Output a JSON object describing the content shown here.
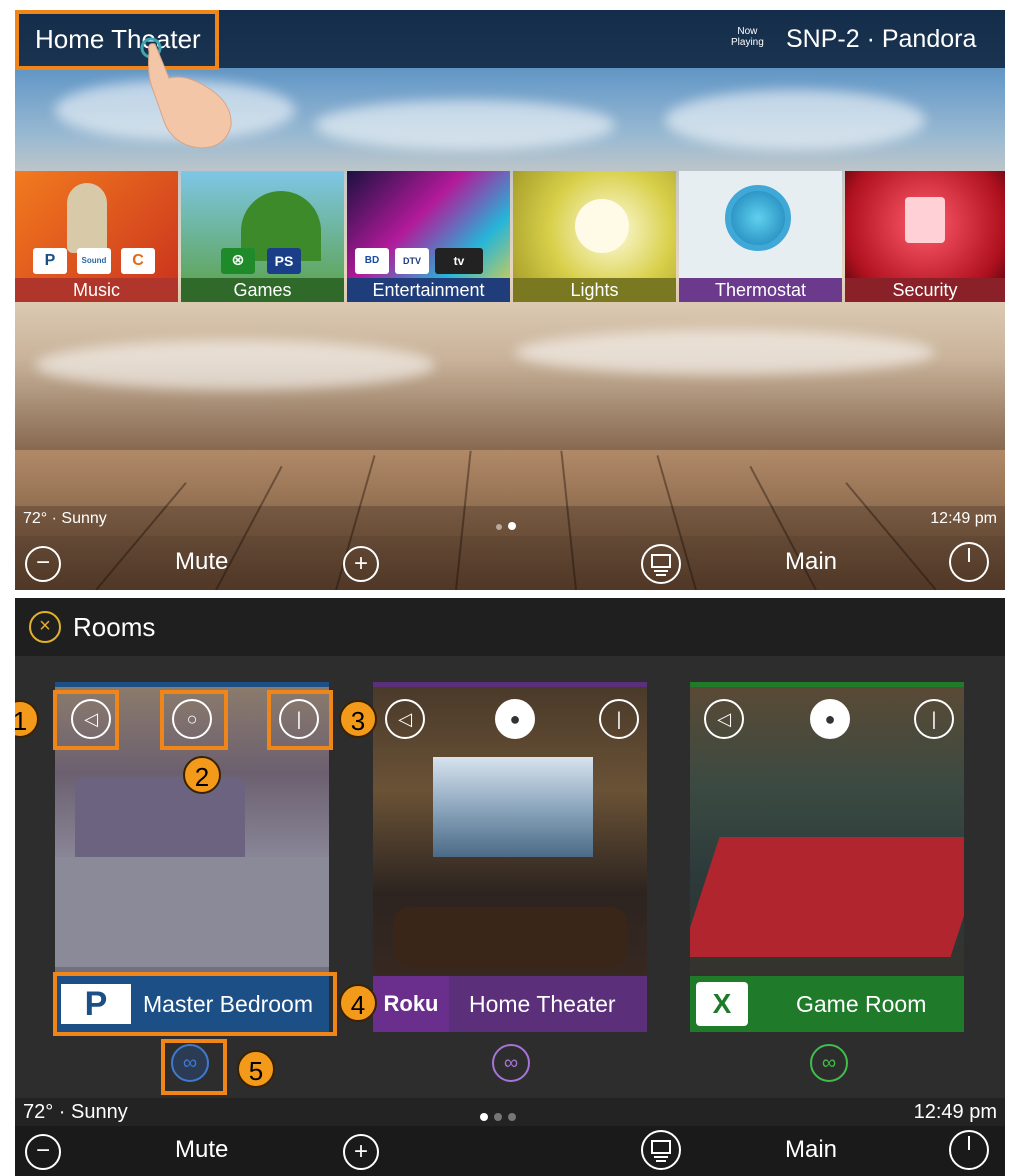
{
  "top_screen": {
    "title": "Home Theater",
    "now_playing_label": "Now\nPlaying",
    "now_playing_value": "SNP-2 · Pandora",
    "tiles": [
      {
        "label": "Music",
        "color": "#b0352a"
      },
      {
        "label": "Games",
        "color": "#2f6a2a"
      },
      {
        "label": "Entertainment",
        "color": "#1f3d7a"
      },
      {
        "label": "Lights",
        "color": "#7a7820"
      },
      {
        "label": "Thermostat",
        "color": "#6b3a8c"
      },
      {
        "label": "Security",
        "color": "#8a2128"
      }
    ],
    "music_badges": [
      "P",
      "Sound",
      "C"
    ],
    "status_left": "72° · Sunny",
    "status_right": "12:49 pm",
    "footer": {
      "minus": "−",
      "mute": "Mute",
      "plus": "+",
      "main": "Main"
    }
  },
  "bottom_screen": {
    "header_title": "Rooms",
    "rooms": [
      {
        "name": "Master Bedroom",
        "badge": "P",
        "accent": "#1c4f86",
        "link_color": "#3f7ad0"
      },
      {
        "name": "Home Theater",
        "badge": "Roku",
        "accent": "#5c2f7a",
        "link_color": "#a574d6"
      },
      {
        "name": "Game Room",
        "badge": "X",
        "accent": "#1f7a2a",
        "link_color": "#3fbf4a"
      }
    ],
    "callouts": [
      "1",
      "2",
      "3",
      "4",
      "5"
    ],
    "status_left": "72° · Sunny",
    "status_right": "12:49 pm",
    "footer": {
      "minus": "−",
      "mute": "Mute",
      "plus": "+",
      "main": "Main"
    }
  },
  "colors": {
    "highlight": "#f0861a",
    "callout": "#f39a1b"
  }
}
